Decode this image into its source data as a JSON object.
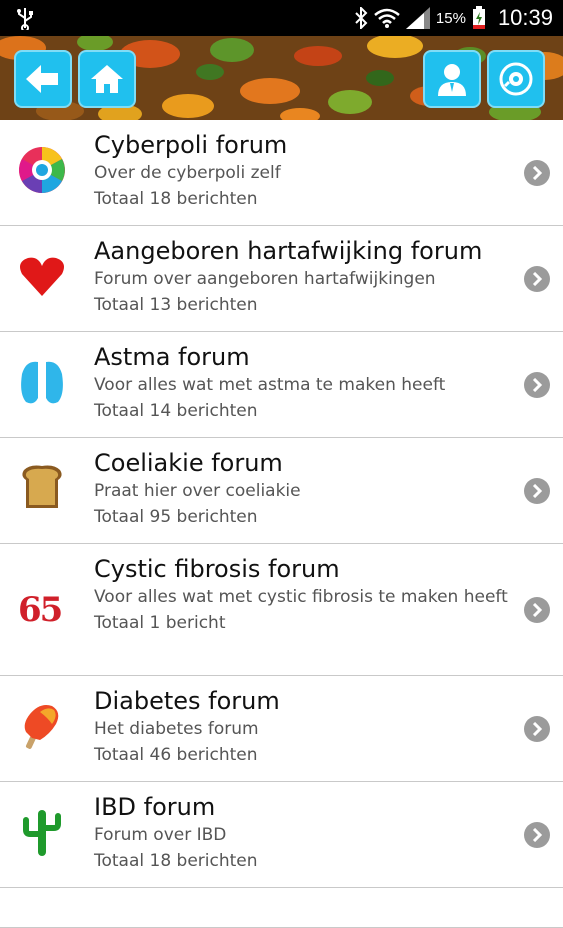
{
  "status_bar": {
    "battery_percent": "15%",
    "time": "10:39",
    "icons": [
      "usb-icon",
      "bluetooth-icon",
      "wifi-icon",
      "signal-icon",
      "battery-charging-icon"
    ]
  },
  "header": {
    "buttons": [
      "back-arrow-icon",
      "home-icon",
      "profile-icon",
      "settings-icon"
    ],
    "accent_color": "#20c0ee"
  },
  "forums": [
    {
      "title": "Cyberpoli forum",
      "description": "Over de cyberpoli zelf",
      "count": "Totaal 18 berichten",
      "icon": "colorwheel-icon"
    },
    {
      "title": "Aangeboren hartafwijking forum",
      "description": "Forum over aangeboren hartafwijkingen",
      "count": "Totaal 13 berichten",
      "icon": "heart-icon"
    },
    {
      "title": "Astma forum",
      "description": "Voor alles wat met astma te maken heeft",
      "count": "Totaal 14 berichten",
      "icon": "lungs-icon"
    },
    {
      "title": "Coeliakie forum",
      "description": "Praat hier over coeliakie",
      "count": "Totaal 95 berichten",
      "icon": "bread-icon"
    },
    {
      "title": "Cystic fibrosis forum",
      "description": "Voor alles wat met cystic fibrosis te maken heeft",
      "count": "Totaal 1 bericht",
      "icon": "number-65-icon",
      "icon_text": "65"
    },
    {
      "title": "Diabetes forum",
      "description": "Het diabetes forum",
      "count": "Totaal 46 berichten",
      "icon": "popsicle-icon"
    },
    {
      "title": "IBD forum",
      "description": "Forum over IBD",
      "count": "Totaal 18 berichten",
      "icon": "cactus-icon"
    }
  ]
}
